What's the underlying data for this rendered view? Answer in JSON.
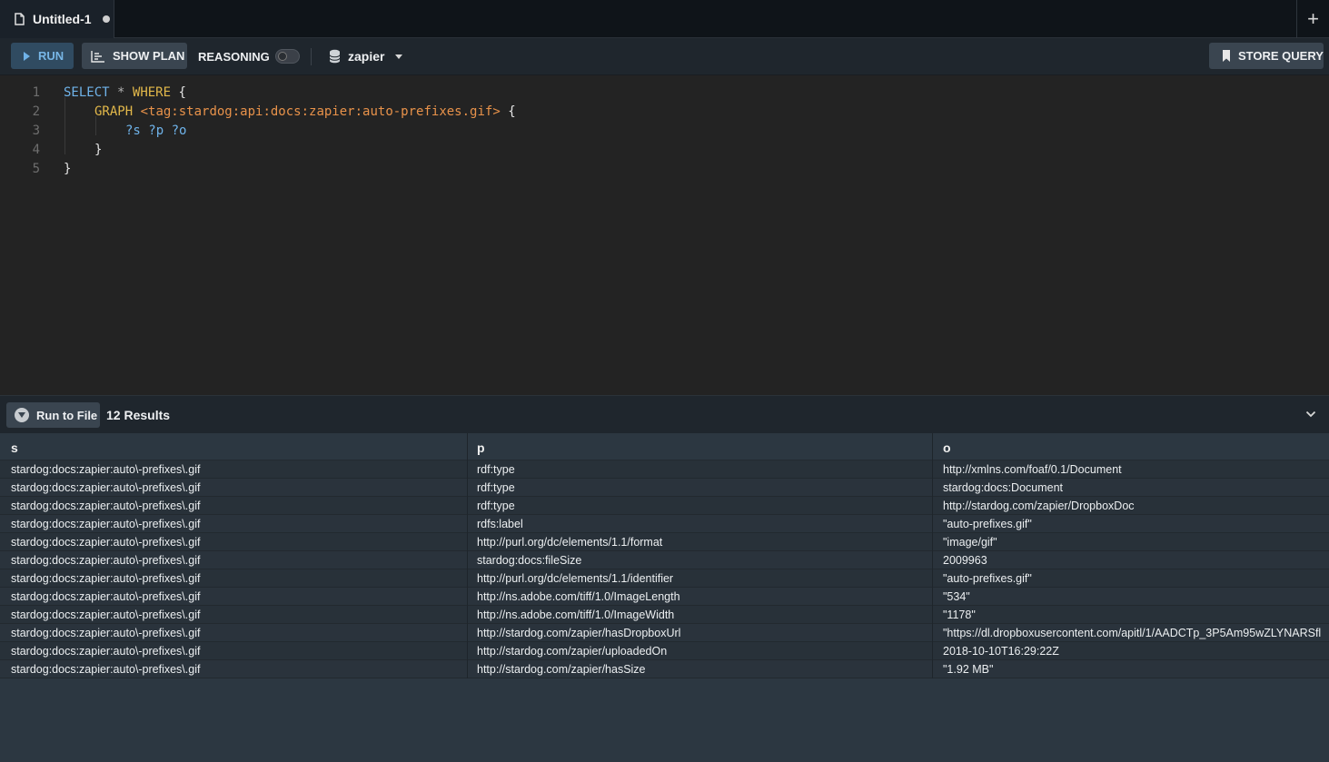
{
  "tab": {
    "title": "Untitled-1",
    "new_tab": "+"
  },
  "toolbar": {
    "run": "RUN",
    "show_plan": "SHOW PLAN",
    "reasoning": "REASONING",
    "database": "zapier",
    "store_query": "STORE QUERY"
  },
  "editor": {
    "line_numbers": [
      "1",
      "2",
      "3",
      "4",
      "5"
    ],
    "select_kw": "SELECT",
    "star": "*",
    "where_kw": "WHERE",
    "open_brace": "{",
    "graph_kw": "GRAPH",
    "graph_iri": "<tag:stardog:api:docs:zapier:auto-prefixes.gif>",
    "vars": "?s ?p ?o",
    "close_brace": "}"
  },
  "results": {
    "run_to_file": "Run to File",
    "count": "12 Results",
    "columns": [
      "s",
      "p",
      "o"
    ],
    "rows": [
      [
        "stardog:docs:zapier:auto\\-prefixes\\.gif",
        "rdf:type",
        "http://xmlns.com/foaf/0.1/Document"
      ],
      [
        "stardog:docs:zapier:auto\\-prefixes\\.gif",
        "rdf:type",
        "stardog:docs:Document"
      ],
      [
        "stardog:docs:zapier:auto\\-prefixes\\.gif",
        "rdf:type",
        "http://stardog.com/zapier/DropboxDoc"
      ],
      [
        "stardog:docs:zapier:auto\\-prefixes\\.gif",
        "rdfs:label",
        "\"auto-prefixes.gif\""
      ],
      [
        "stardog:docs:zapier:auto\\-prefixes\\.gif",
        "http://purl.org/dc/elements/1.1/format",
        "\"image/gif\""
      ],
      [
        "stardog:docs:zapier:auto\\-prefixes\\.gif",
        "stardog:docs:fileSize",
        "2009963"
      ],
      [
        "stardog:docs:zapier:auto\\-prefixes\\.gif",
        "http://purl.org/dc/elements/1.1/identifier",
        "\"auto-prefixes.gif\""
      ],
      [
        "stardog:docs:zapier:auto\\-prefixes\\.gif",
        "http://ns.adobe.com/tiff/1.0/ImageLength",
        "\"534\""
      ],
      [
        "stardog:docs:zapier:auto\\-prefixes\\.gif",
        "http://ns.adobe.com/tiff/1.0/ImageWidth",
        "\"1178\""
      ],
      [
        "stardog:docs:zapier:auto\\-prefixes\\.gif",
        "http://stardog.com/zapier/hasDropboxUrl",
        "\"https://dl.dropboxusercontent.com/apitl/1/AADCTp_3P5Am95wZLYNARSfl"
      ],
      [
        "stardog:docs:zapier:auto\\-prefixes\\.gif",
        "http://stardog.com/zapier/uploadedOn",
        "2018-10-10T16:29:22Z"
      ],
      [
        "stardog:docs:zapier:auto\\-prefixes\\.gif",
        "http://stardog.com/zapier/hasSize",
        "\"1.92 MB\""
      ]
    ]
  }
}
